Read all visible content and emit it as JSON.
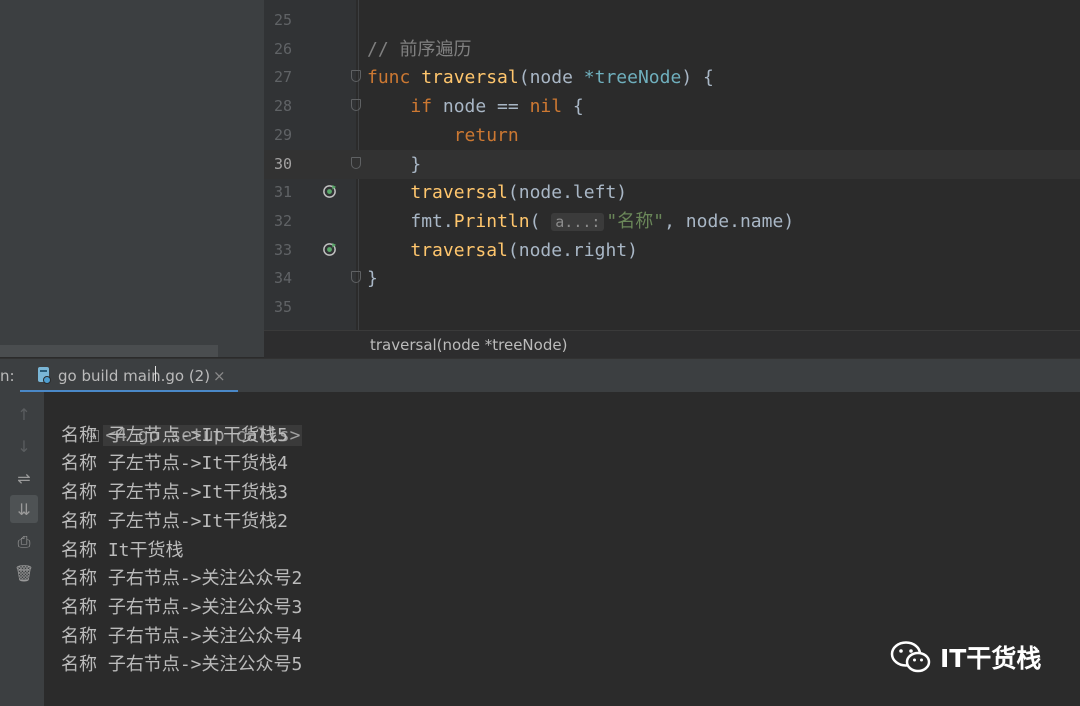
{
  "colors": {
    "editor_bg": "#2b2b2b",
    "panel_bg": "#3c3f41",
    "keyword": "#cc7832",
    "function": "#ffc66d",
    "type": "#6fafbd",
    "comment": "#808080",
    "string": "#6a8759",
    "text": "#a9b7c6",
    "accent": "#4a88c7"
  },
  "editor": {
    "lines": [
      {
        "num": "25",
        "tokens": []
      },
      {
        "num": "26",
        "tokens": [
          {
            "t": "// 前序遍历",
            "c": "cm"
          }
        ]
      },
      {
        "num": "27",
        "fold": true,
        "tokens": [
          {
            "t": "func ",
            "c": "kw"
          },
          {
            "t": "traversal",
            "c": "fn"
          },
          {
            "t": "(node ",
            "c": ""
          },
          {
            "t": "*treeNode",
            "c": "ty"
          },
          {
            "t": ") {",
            "c": ""
          }
        ]
      },
      {
        "num": "28",
        "fold": true,
        "tokens": [
          {
            "t": "    ",
            "c": ""
          },
          {
            "t": "if ",
            "c": "kw"
          },
          {
            "t": "node == ",
            "c": ""
          },
          {
            "t": "nil",
            "c": "kw"
          },
          {
            "t": " {",
            "c": ""
          }
        ]
      },
      {
        "num": "29",
        "tokens": [
          {
            "t": "        ",
            "c": ""
          },
          {
            "t": "return",
            "c": "kw"
          }
        ]
      },
      {
        "num": "30",
        "current": true,
        "fold": true,
        "tokens": [
          {
            "t": "    }",
            "c": ""
          }
        ]
      },
      {
        "num": "31",
        "recursive": true,
        "tokens": [
          {
            "t": "    ",
            "c": ""
          },
          {
            "t": "traversal",
            "c": "fn"
          },
          {
            "t": "(node.left)",
            "c": ""
          }
        ]
      },
      {
        "num": "32",
        "tokens": [
          {
            "t": "    ",
            "c": ""
          },
          {
            "t": "fmt",
            "c": ""
          },
          {
            "t": ".",
            "c": ""
          },
          {
            "t": "Println",
            "c": "fn"
          },
          {
            "t": "( ",
            "c": ""
          },
          {
            "t": "a...:",
            "c": "hint"
          },
          {
            "t": "\"名称\"",
            "c": "st"
          },
          {
            "t": ", node.name)",
            "c": ""
          }
        ]
      },
      {
        "num": "33",
        "recursive": true,
        "tokens": [
          {
            "t": "    ",
            "c": ""
          },
          {
            "t": "traversal",
            "c": "fn"
          },
          {
            "t": "(node.right)",
            "c": ""
          }
        ]
      },
      {
        "num": "34",
        "fold": true,
        "tokens": [
          {
            "t": "}",
            "c": ""
          }
        ]
      },
      {
        "num": "35",
        "tokens": []
      }
    ],
    "breadcrumb": "traversal(node *treeNode)"
  },
  "run_panel": {
    "label": "n:",
    "tab_label": "go build main.go (2)",
    "tab_close": "×",
    "tools": [
      {
        "name": "up-arrow-icon",
        "glyph": "↑",
        "disabled": true
      },
      {
        "name": "down-arrow-icon",
        "glyph": "↓",
        "disabled": true
      },
      {
        "name": "soft-wrap-icon",
        "glyph": "⇌"
      },
      {
        "name": "scroll-to-end-icon",
        "glyph": "⇊",
        "active": true
      },
      {
        "name": "print-icon",
        "glyph": "⎙"
      },
      {
        "name": "trash-icon",
        "glyph": "🗑"
      }
    ],
    "setup_calls": "<4 go setup calls>",
    "output": [
      "名称 子左节点->It干货栈5",
      "名称 子左节点->It干货栈4",
      "名称 子左节点->It干货栈3",
      "名称 子左节点->It干货栈2",
      "名称 It干货栈",
      "名称 子右节点->关注公众号2",
      "名称 子右节点->关注公众号3",
      "名称 子右节点->关注公众号4",
      "名称 子右节点->关注公众号5"
    ]
  },
  "watermark": {
    "text": "IT干货栈",
    "icon": "wechat-icon"
  }
}
